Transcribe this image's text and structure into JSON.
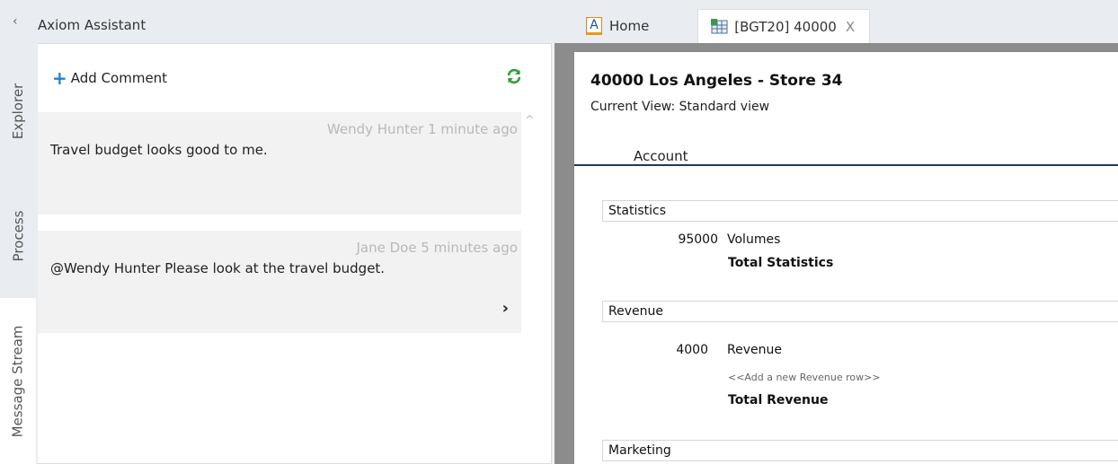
{
  "assistant": {
    "collapse_glyph": "‹",
    "title": "Axiom Assistant"
  },
  "side_tabs": [
    {
      "label": "Explorer"
    },
    {
      "label": "Process"
    },
    {
      "label": "Message Stream"
    }
  ],
  "panel": {
    "add_comment_label": "Add Comment",
    "plus_glyph": "+",
    "refresh_icon": "refresh-icon",
    "scroll_up_glyph": "^",
    "expand_glyph": "›",
    "messages": [
      {
        "author_time": "Wendy Hunter 1 minute ago",
        "text": "Travel budget looks good to me."
      },
      {
        "author_time": "Jane Doe 5 minutes ago",
        "text": "@Wendy Hunter Please look at the travel budget."
      }
    ]
  },
  "tabs": {
    "home_icon_letter": "A",
    "home_label": "Home",
    "doc_label": "[BGT20] 40000",
    "close_glyph": "X"
  },
  "document": {
    "title": "40000 Los Angeles - Store 34",
    "view_label": "Current View:  Standard view",
    "column_header": "Account",
    "sections": {
      "statistics": {
        "name": "Statistics",
        "row_number": "95000",
        "row_label": "Volumes",
        "total": "Total Statistics"
      },
      "revenue": {
        "name": "Revenue",
        "row_number": "4000",
        "row_label": "Revenue",
        "add_row": "<<Add a new Revenue row>>",
        "total": "Total Revenue"
      },
      "marketing": {
        "name": "Marketing"
      }
    }
  },
  "colors": {
    "accent_blue": "#1f7fd1",
    "refresh_green": "#2e9e3a",
    "header_rule": "#1f3a5a",
    "frame_gray": "#8c8c8c"
  }
}
